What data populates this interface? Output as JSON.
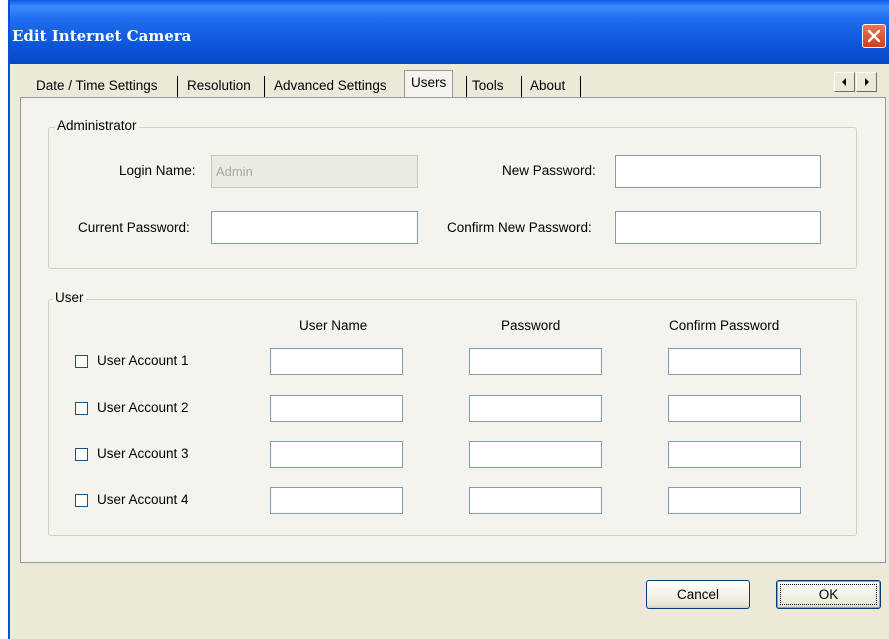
{
  "window": {
    "title": "Edit Internet Camera"
  },
  "tabs": [
    {
      "label": "Date / Time Settings"
    },
    {
      "label": "Resolution"
    },
    {
      "label": "Advanced Settings"
    },
    {
      "label": "Users"
    },
    {
      "label": "Tools"
    },
    {
      "label": "About"
    }
  ],
  "active_tab": "Users",
  "administrator": {
    "legend": "Administrator",
    "login_name_label": "Login Name:",
    "login_name_value": "Admin",
    "current_password_label": "Current Password:",
    "current_password_value": "",
    "new_password_label": "New Password:",
    "new_password_value": "",
    "confirm_new_password_label": "Confirm New Password:",
    "confirm_new_password_value": ""
  },
  "user": {
    "legend": "User",
    "col_user_name": "User Name",
    "col_password": "Password",
    "col_confirm_password": "Confirm Password",
    "accounts": [
      {
        "label": "User Account 1",
        "checked": false,
        "user_name": "",
        "password": "",
        "confirm": ""
      },
      {
        "label": "User Account 2",
        "checked": false,
        "user_name": "",
        "password": "",
        "confirm": ""
      },
      {
        "label": "User Account 3",
        "checked": false,
        "user_name": "",
        "password": "",
        "confirm": ""
      },
      {
        "label": "User Account 4",
        "checked": false,
        "user_name": "",
        "password": "",
        "confirm": ""
      }
    ]
  },
  "buttons": {
    "cancel": "Cancel",
    "ok": "OK"
  },
  "colors": {
    "titlebar": "#0a5ce8",
    "close": "#d33d17",
    "dialog_bg": "#ece9d8",
    "panel_bg": "#f4f3ee"
  }
}
